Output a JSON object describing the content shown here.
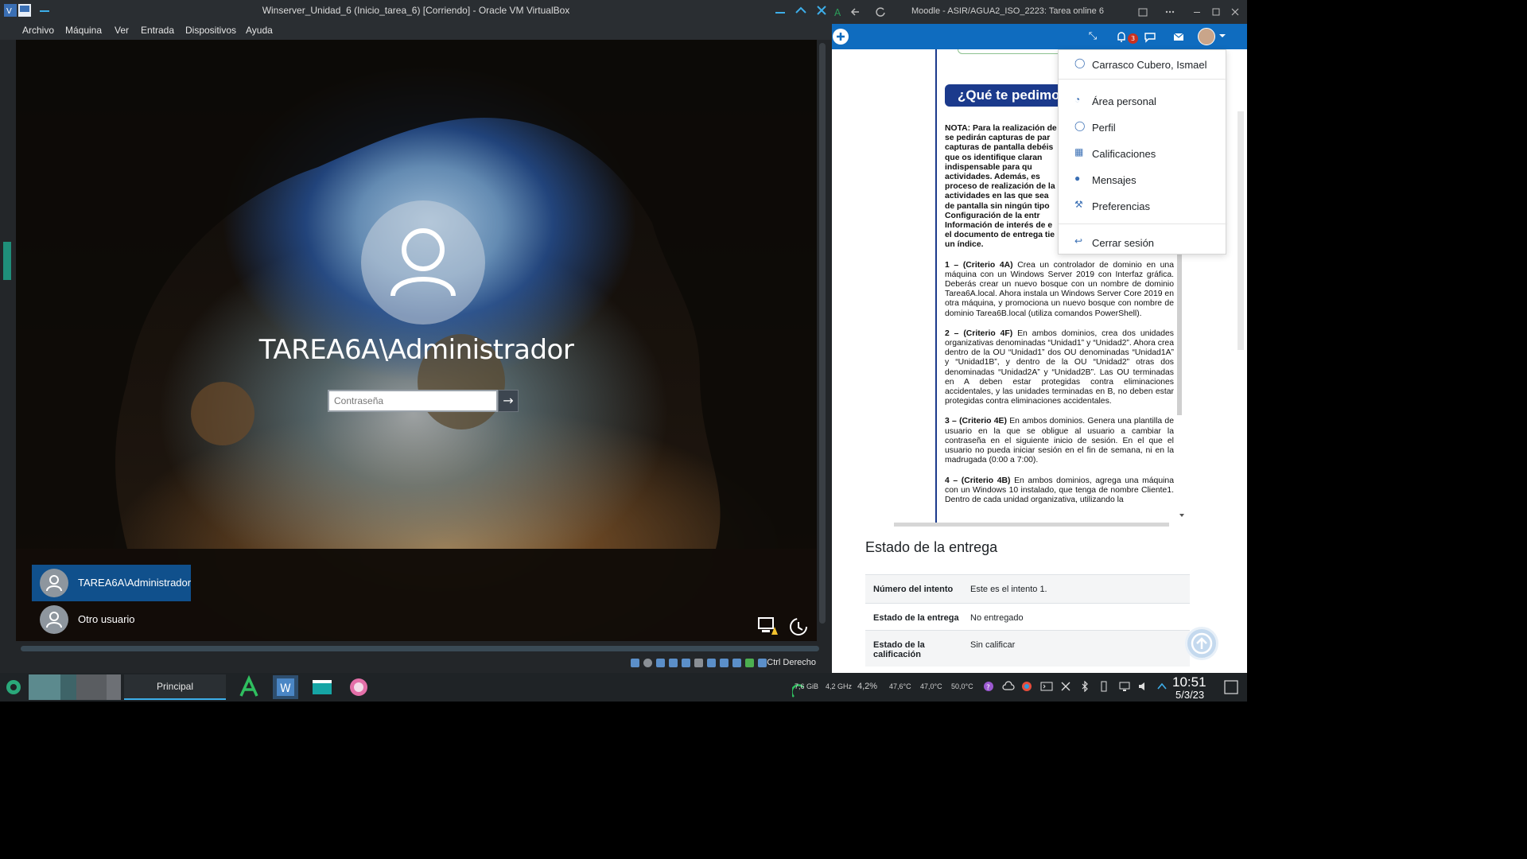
{
  "vbox": {
    "title": "Winserver_Unidad_6 (Inicio_tarea_6) [Corriendo] - Oracle VM VirtualBox",
    "menu": [
      "Archivo",
      "Máquina",
      "Ver",
      "Entrada",
      "Dispositivos",
      "Ayuda"
    ],
    "status_host_key": "Ctrl Derecho"
  },
  "lockscreen": {
    "user": "TAREA6A\\Administrador",
    "password_placeholder": "Contraseña",
    "users": [
      {
        "label": "TAREA6A\\Administrador",
        "selected": true
      },
      {
        "label": "Otro usuario",
        "selected": false
      }
    ]
  },
  "browser": {
    "title": "Moodle - ASIR/AGUA2_ISO_2223: Tarea online 6",
    "notification_count": "3",
    "user_menu": {
      "name": "Carrasco Cubero, Ismael",
      "items": [
        "Área personal",
        "Perfil",
        "Calificaciones",
        "Mensajes",
        "Preferencias"
      ],
      "logout": "Cerrar sesión"
    },
    "doc": {
      "heading": "¿Qué te pedimos",
      "note_lines": [
        "NOTA: Para la realización de",
        "se pedirán capturas de par",
        "capturas de pantalla debéis",
        "que os identifique claran",
        "indispensable para qu",
        "actividades. Además, es",
        "proceso de realización de la",
        "actividades en las que sea",
        "de pantalla sin ningún tipo",
        "Configuración de la entr",
        "Información de interés de e",
        "el documento de entrega tie",
        "un índice."
      ],
      "criteria": [
        {
          "label": "1 – (Criterio 4A)",
          "text": " Crea un controlador de dominio en una máquina con un Windows Server 2019 con Interfaz gráfica. Deberás crear un nuevo bosque con un nombre de dominio Tarea6A.local. Ahora instala un Windows Server Core 2019 en otra máquina, y promociona un nuevo bosque con nombre de dominio Tarea6B.local (utiliza comandos PowerShell)."
        },
        {
          "label": "2 – (Criterio 4F)",
          "text": " En ambos dominios, crea dos unidades organizativas denominadas “Unidad1” y “Unidad2”. Ahora crea dentro de la OU “Unidad1” dos OU denominadas “Unidad1A” y “Unidad1B”, y dentro de la OU “Unidad2” otras dos denominadas “Unidad2A” y “Unidad2B”. Las OU terminadas en A deben estar protegidas contra eliminaciones accidentales, y las unidades terminadas en B, no deben estar protegidas contra eliminaciones accidentales."
        },
        {
          "label": "3 – (Criterio 4E)",
          "text": " En ambos dominios. Genera una plantilla de usuario en la que se obligue al usuario a cambiar la contraseña en el siguiente inicio de sesión. En el que el usuario no pueda iniciar sesión en el fin de semana, ni en la madrugada (0:00 a 7:00)."
        },
        {
          "label": "4 – (Criterio 4B)",
          "text": " En ambos dominios, agrega una máquina con un Windows 10 instalado, que tenga de nombre Cliente1. Dentro de cada unidad organizativa, utilizando la"
        }
      ]
    },
    "estado": {
      "title": "Estado de la entrega",
      "rows": [
        {
          "k": "Número del intento",
          "v": "Este es el intento 1."
        },
        {
          "k": "Estado de la entrega",
          "v": "No entregado"
        },
        {
          "k": "Estado de la calificación",
          "v": "Sin calificar"
        }
      ]
    }
  },
  "taskbar": {
    "principal": "Principal",
    "tray": [
      "7,6 GiB",
      "4,2 GHz",
      "4,2%",
      "47,6°C",
      "47,0°C",
      "50,0°C"
    ],
    "time": "10:51",
    "date": "5/3/23"
  },
  "colors": {
    "moodle_blue": "#0f6cbf",
    "doc_heading": "#1b3a8c",
    "win_selected": "#10508c",
    "badge": "#ca3120"
  }
}
